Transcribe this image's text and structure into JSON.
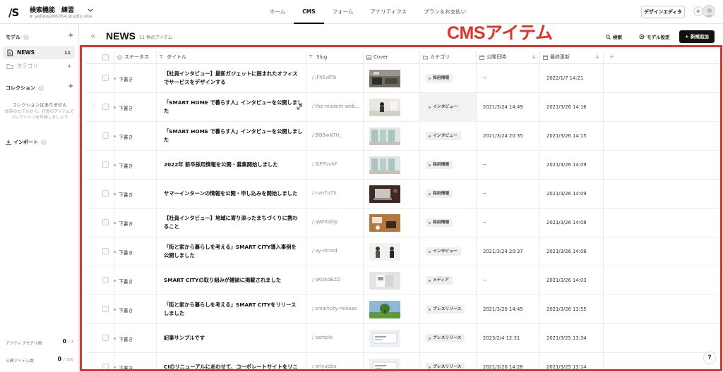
{
  "topbar": {
    "logo": "/S",
    "project_name": "検索機能　練習",
    "project_url": "yellow286364.studio.site",
    "nav": [
      {
        "label": "ホーム",
        "active": false
      },
      {
        "label": "CMS",
        "active": true
      },
      {
        "label": "フォーム",
        "active": false
      },
      {
        "label": "アナリティクス",
        "active": false
      },
      {
        "label": "プラン＆お支払い",
        "active": false
      }
    ],
    "design_editor": "デザインエディタ"
  },
  "sidebar": {
    "model_heading": "モデル",
    "models": [
      {
        "label": "NEWS",
        "count": "11",
        "active": true
      },
      {
        "label": "カテゴリ",
        "count": "4",
        "active": false
      }
    ],
    "collection_heading": "コレクション",
    "collection_empty": "コレクションはありません",
    "collection_empty_sub_1": "既存のモデルから、任意のアイテムで",
    "collection_empty_sub_2": "コレクションを作成しましょう",
    "import_label": "インポート",
    "active_models_label": "アクティブモデル数",
    "active_models_value": "0",
    "active_models_limit": "/ 3",
    "public_items_label": "公開アイテム数",
    "public_items_value": "0",
    "public_items_limit": "/ 100"
  },
  "header": {
    "collapse": "«",
    "title": "NEWS",
    "count": "11 件のアイテム",
    "search": "検索",
    "model_settings": "モデル設定",
    "add_new": "新規追加"
  },
  "annotation": "CMSアイテム",
  "columns": [
    {
      "label": "ステータス"
    },
    {
      "label": "タイトル"
    },
    {
      "label": "Slug"
    },
    {
      "label": "Cover"
    },
    {
      "label": "カテゴリ"
    },
    {
      "label": "公開日時"
    },
    {
      "label": "最終更新"
    }
  ],
  "rows": [
    {
      "status": "下書き",
      "title_1": "【社員インタビュー】最新ガジェットに囲まれたオフィス",
      "title_2": "でサービスをデザインする",
      "slug": "/ jFh5vRTe",
      "cover": "office",
      "category": "採用情報",
      "published": "--",
      "updated": "2022/1/7 14:21"
    },
    {
      "status": "下書き",
      "title_1": "「SMART HOME で暮らす人」インタビューを公開しまし",
      "title_2": "た",
      "slug": "/ the-modern-web...",
      "cover": "woman",
      "category": "インタビュー",
      "published": "2021/3/24 14:49",
      "updated": "2021/3/26 14:16"
    },
    {
      "status": "下書き",
      "title_1": "「SMART HOME で暮らす人」インタビューを公開しまし",
      "title_2": "た",
      "slug": "/ BQ5wN7H_",
      "cover": "room",
      "category": "インタビュー",
      "published": "2021/3/24 20:35",
      "updated": "2021/3/26 14:15"
    },
    {
      "status": "下書き",
      "title_1": "2022年 新卒採用情報を公開・募集開始しました",
      "title_2": "",
      "slug": "/ SiFFUxhF",
      "cover": "room",
      "category": "採用情報",
      "published": "--",
      "updated": "2021/3/26 14:09"
    },
    {
      "status": "下書き",
      "title_1": "サマーインターンの情報を公開・申し込みを開始しました",
      "title_2": "",
      "slug": "/ r-zn7o7S",
      "cover": "laptop",
      "category": "採用情報",
      "published": "--",
      "updated": "2021/3/26 14:09"
    },
    {
      "status": "下書き",
      "title_1": "【社員インタビュー】地域に寄り添ったまちづくりに携わ",
      "title_2": "ること",
      "slug": "/ qWrKsbly",
      "cover": "desk",
      "category": "採用情報",
      "published": "--",
      "updated": "2021/3/26 14:08"
    },
    {
      "status": "下書き",
      "title_1": "「街と家から暮らしを考える」SMART CITY導入事例を",
      "title_2": "公開しました",
      "slug": "/ ay-otrmd",
      "cover": "people",
      "category": "インタビュー",
      "published": "2021/3/24 20:37",
      "updated": "2021/3/26 14:08"
    },
    {
      "status": "下書き",
      "title_1": "SMART CITYの取り組みが雑誌に掲載されました",
      "title_2": "",
      "slug": "/ oKUkdEZD",
      "cover": "book",
      "category": "メディア",
      "published": "--",
      "updated": "2021/3/26 14:03"
    },
    {
      "status": "下書き",
      "title_1": "「街と家から暮らしを考える」SMART CITYをリリース",
      "title_2": "しました",
      "slug": "/ smartcity-release",
      "cover": "park",
      "category": "プレスリリース",
      "published": "2021/3/20 14:45",
      "updated": "2021/3/26 13:55"
    },
    {
      "status": "下書き",
      "title_1": "記事サンプルです",
      "title_2": "",
      "slug": "/ sample",
      "cover": "card",
      "category": "プレスリリース",
      "published": "2023/2/4 12:31",
      "updated": "2021/3/25 13:34"
    },
    {
      "status": "下書き",
      "title_1": "CIのリニューアルにあわせて、コーポレートサイトをリニ",
      "title_2": "",
      "slug": "/ erlyubbo",
      "cover": "card",
      "category": "プレスリリース",
      "published": "2021/3/20 14:28",
      "updated": "2021/3/25 13:14"
    }
  ],
  "help": "?",
  "colors": {
    "annotation": "#e53228",
    "primary_button": "#111111"
  }
}
